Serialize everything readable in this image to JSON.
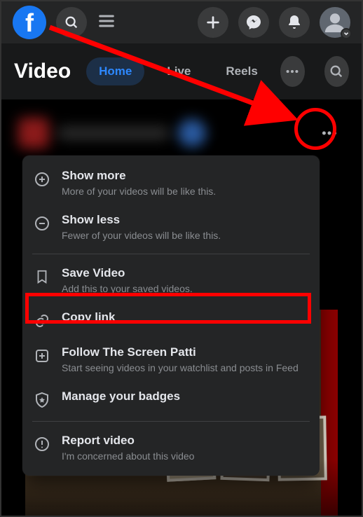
{
  "subnav": {
    "title": "Video",
    "tabs": [
      "Home",
      "Live",
      "Reels"
    ]
  },
  "icons": {
    "search": "search-icon",
    "hamburger": "menu-icon",
    "plus": "plus-icon",
    "messenger": "messenger-icon",
    "bell": "bell-icon",
    "avatar": "avatar-icon",
    "more": "more-icon"
  },
  "menu": {
    "show_more": {
      "title": "Show more",
      "sub": "More of your videos will be like this."
    },
    "show_less": {
      "title": "Show less",
      "sub": "Fewer of your videos will be like this."
    },
    "save": {
      "title": "Save Video",
      "sub": "Add this to your saved videos."
    },
    "copy": {
      "title": "Copy link"
    },
    "follow": {
      "title": "Follow The Screen Patti",
      "sub": "Start seeing videos in your watchlist and posts in Feed"
    },
    "badges": {
      "title": "Manage your badges"
    },
    "report": {
      "title": "Report video",
      "sub": "I'm concerned about this video"
    }
  },
  "annotation": {
    "arrow_color": "#ff0000",
    "circle_target": "post-more-button",
    "highlight_target": "menu-copy-link"
  }
}
